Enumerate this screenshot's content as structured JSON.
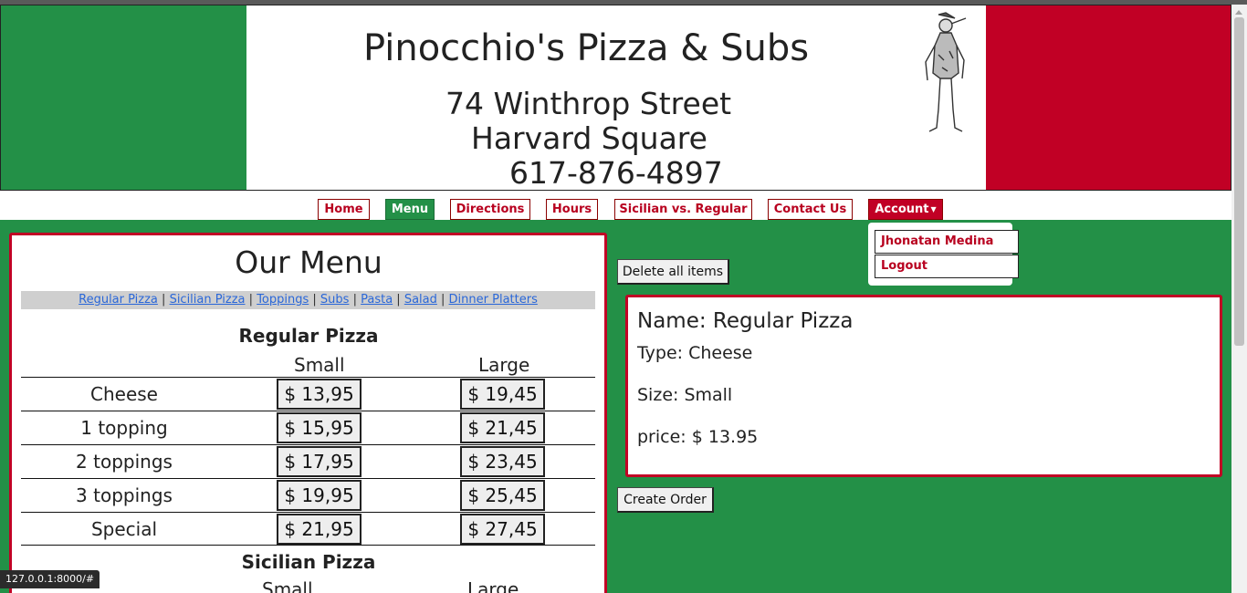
{
  "header": {
    "title": "Pinocchio's Pizza & Subs",
    "address_line1": "74 Winthrop Street",
    "address_line2": "Harvard Square",
    "phone": "617-876-4897"
  },
  "nav": {
    "home": "Home",
    "menu": "Menu",
    "directions": "Directions",
    "hours": "Hours",
    "sicilian_vs_regular": "Sicilian vs. Regular",
    "contact": "Contact Us",
    "account": "Account"
  },
  "account_dropdown": {
    "user": "Jhonatan Medina",
    "logout": "Logout"
  },
  "menu": {
    "title": "Our Menu",
    "categories": [
      "Regular Pizza",
      "Sicilian Pizza",
      "Toppings",
      "Subs",
      "Pasta",
      "Salad",
      "Dinner Platters"
    ],
    "regular": {
      "title": "Regular Pizza",
      "col_small": "Small",
      "col_large": "Large",
      "rows": [
        {
          "label": "Cheese",
          "small": "$ 13,95",
          "large": "$ 19,45"
        },
        {
          "label": "1 topping",
          "small": "$ 15,95",
          "large": "$ 21,45"
        },
        {
          "label": "2 toppings",
          "small": "$ 17,95",
          "large": "$ 23,45"
        },
        {
          "label": "3 toppings",
          "small": "$ 19,95",
          "large": "$ 25,45"
        },
        {
          "label": "Special",
          "small": "$ 21,95",
          "large": "$ 27,45"
        }
      ]
    },
    "sicilian": {
      "title": "Sicilian Pizza",
      "col_small": "Small",
      "col_large": "Large"
    }
  },
  "cart": {
    "delete_all": "Delete all items",
    "name": "Name: Regular Pizza",
    "type": "Type: Cheese",
    "size": "Size: Small",
    "price": "price: $ 13.95",
    "create_order": "Create Order"
  },
  "status_bar": "127.0.0.1:8000/#",
  "colors": {
    "green": "#239047",
    "red": "#c10025"
  }
}
